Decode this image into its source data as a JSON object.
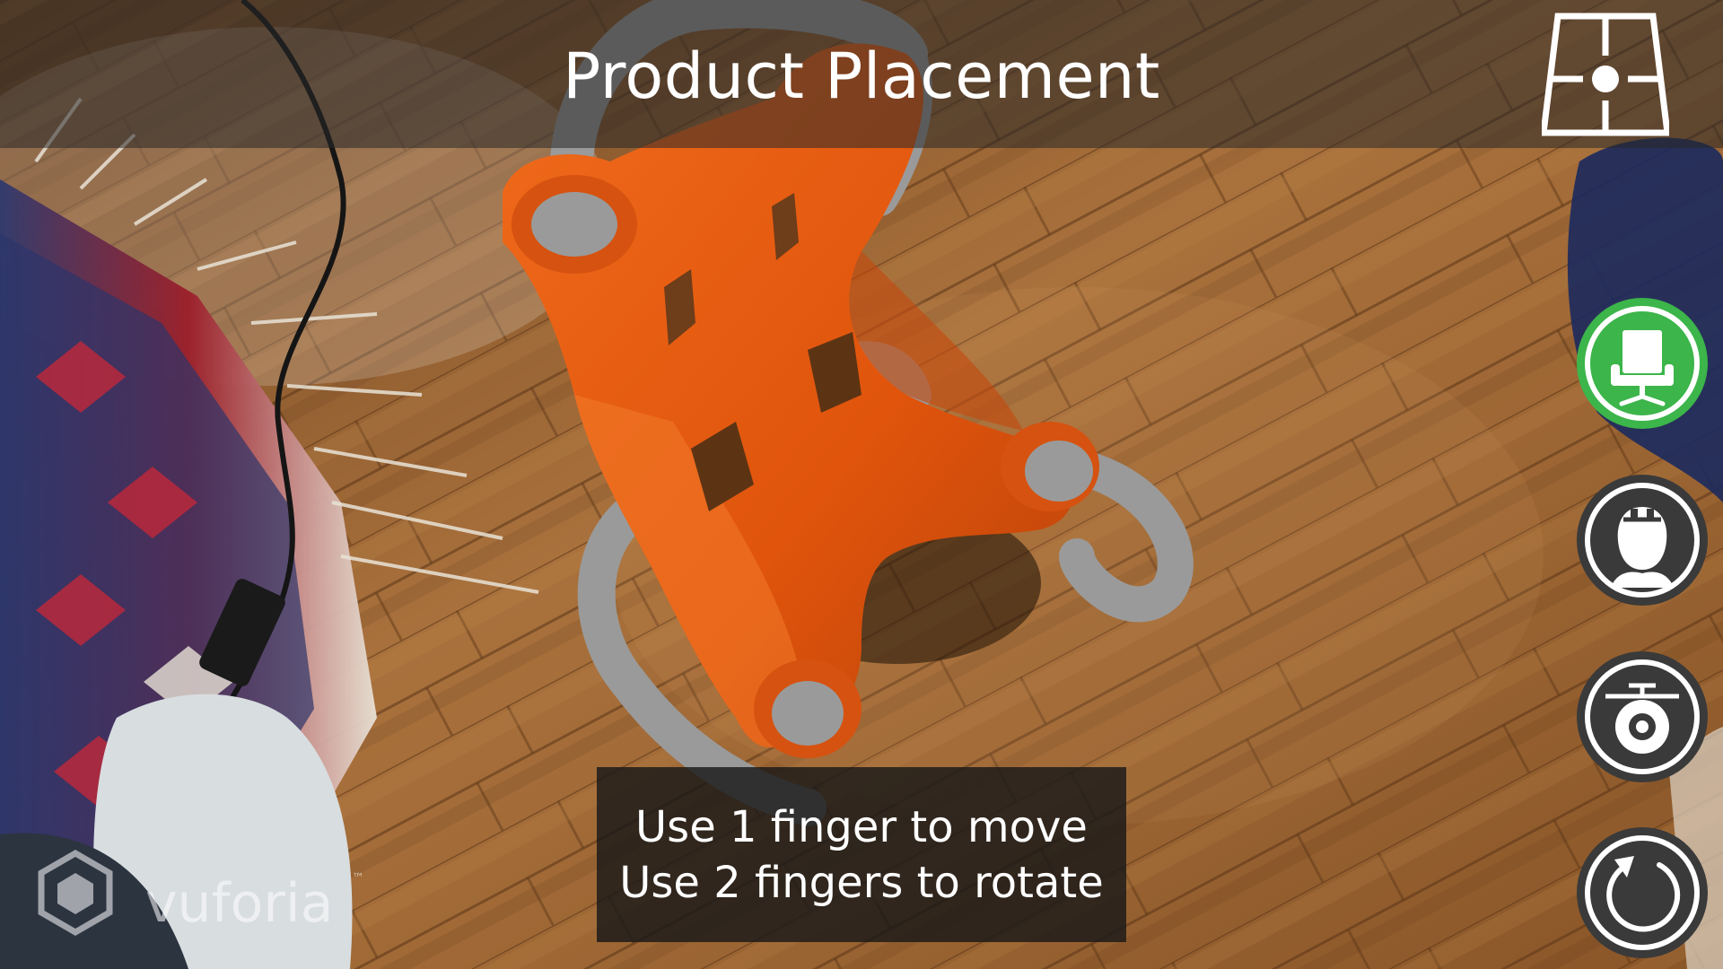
{
  "header": {
    "title": "Product Placement",
    "ground_plane_icon": "ground-plane-floor-icon"
  },
  "sidebar": {
    "buttons": [
      {
        "icon": "chair-icon",
        "active": true,
        "color": "#3cb54a"
      },
      {
        "icon": "mid-air-person-icon",
        "active": false,
        "color": "#3a3a3a"
      },
      {
        "icon": "ground-plane-camera-icon",
        "active": false,
        "color": "#3a3a3a"
      },
      {
        "icon": "reset-icon",
        "active": false,
        "color": "#3a3a3a"
      }
    ]
  },
  "instructions": {
    "line1": "Use 1 finger to move",
    "line2": "Use 2 fingers to rotate"
  },
  "watermark": {
    "text": "vuforia",
    "trademark": "™"
  },
  "colors": {
    "chair_orange": "#e85a10",
    "chair_frame_gray": "#9a9a9a",
    "active_green": "#3cb54a",
    "floor_wood": "#a46a36"
  }
}
